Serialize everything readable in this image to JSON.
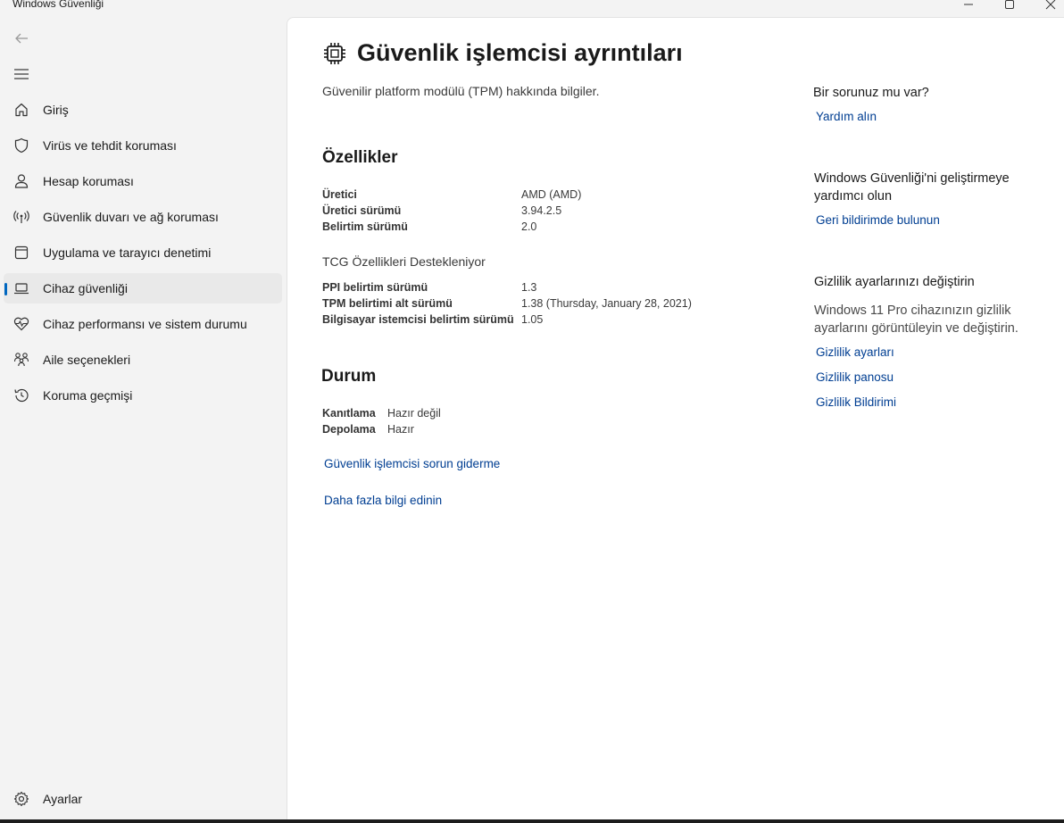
{
  "window": {
    "title": "Windows Güvenliği",
    "controls": {
      "minimize": "—",
      "maximize": "☐",
      "close": "✕"
    }
  },
  "sidebar": {
    "items": [
      {
        "label": "Giriş",
        "icon": "home-icon"
      },
      {
        "label": "Virüs ve tehdit koruması",
        "icon": "shield-icon"
      },
      {
        "label": "Hesap koruması",
        "icon": "person-icon"
      },
      {
        "label": "Güvenlik duvarı ve ağ koruması",
        "icon": "antenna-icon"
      },
      {
        "label": "Uygulama ve tarayıcı denetimi",
        "icon": "app-window-icon"
      },
      {
        "label": "Cihaz güvenliği",
        "icon": "laptop-icon",
        "active": true
      },
      {
        "label": "Cihaz performansı ve sistem durumu",
        "icon": "heart-pulse-icon"
      },
      {
        "label": "Aile seçenekleri",
        "icon": "family-icon"
      },
      {
        "label": "Koruma geçmişi",
        "icon": "history-icon"
      }
    ],
    "settings": {
      "label": "Ayarlar",
      "icon": "gear-icon"
    }
  },
  "main": {
    "title": "Güvenlik işlemcisi ayrıntıları",
    "subtitle": "Güvenilir platform modülü (TPM) hakkında bilgiler.",
    "specs_heading": "Özellikler",
    "specs": [
      {
        "label": "Üretici",
        "value": "AMD (AMD)"
      },
      {
        "label": "Üretici sürümü",
        "value": "3.94.2.5"
      },
      {
        "label": "Belirtim sürümü",
        "value": "2.0"
      }
    ],
    "tcg_heading": "TCG Özellikleri Destekleniyor",
    "tcg": [
      {
        "label": "PPI belirtim sürümü",
        "value": "1.3"
      },
      {
        "label": "TPM belirtimi alt sürümü",
        "value": "1.38 (Thursday, January 28, 2021)"
      },
      {
        "label": "Bilgisayar istemcisi belirtim sürümü",
        "value": "1.05"
      }
    ],
    "status_heading": "Durum",
    "status": [
      {
        "label": "Kanıtlama",
        "value": "Hazır değil"
      },
      {
        "label": "Depolama",
        "value": "Hazır"
      }
    ],
    "links": {
      "troubleshoot": "Güvenlik işlemcisi sorun giderme",
      "learn_more": "Daha fazla bilgi edinin"
    }
  },
  "right_panel": {
    "help_heading": "Bir sorunuz mu var?",
    "help_link": "Yardım alın",
    "improve_heading": "Windows Güvenliği'ni geliştirmeye yardımcı olun",
    "feedback_link": "Geri bildirimde bulunun",
    "privacy_heading": "Gizlilik ayarlarınızı değiştirin",
    "privacy_text": "Windows 11 Pro cihazınızın gizlilik ayarlarını görüntüleyin ve değiştirin.",
    "privacy_links": [
      "Gizlilik ayarları",
      "Gizlilik panosu",
      "Gizlilik Bildirimi"
    ]
  },
  "colors": {
    "accent": "#0067c0",
    "link": "#003e92",
    "sidebar_bg": "#f3f3f3",
    "content_bg": "#ffffff"
  }
}
